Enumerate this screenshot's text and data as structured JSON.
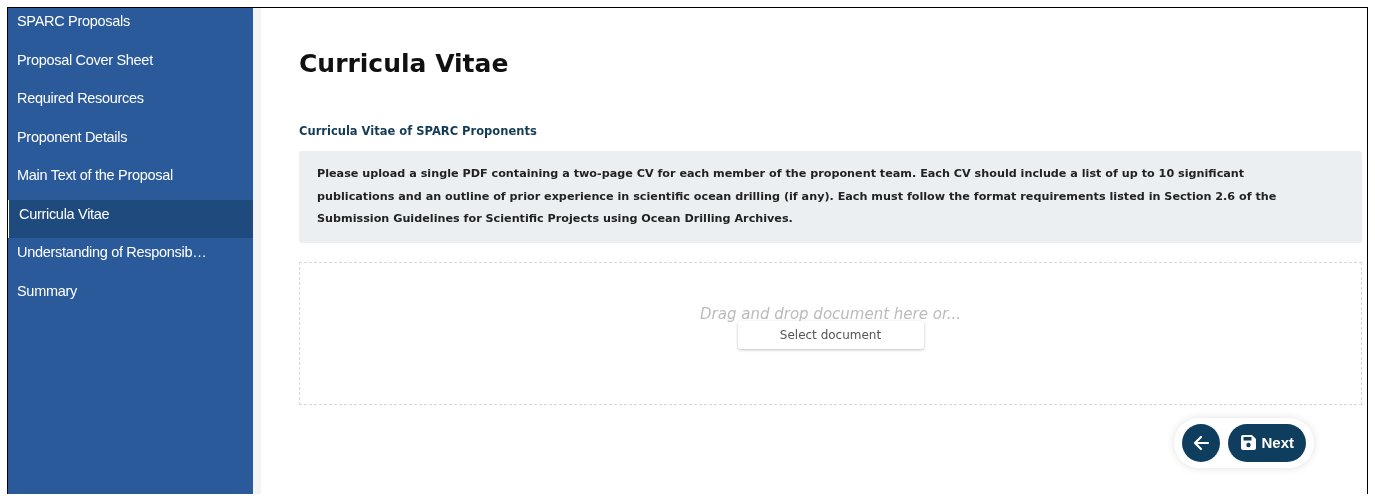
{
  "sidebar": {
    "items": [
      {
        "label": "SPARC Proposals",
        "selected": false
      },
      {
        "label": "Proposal Cover Sheet",
        "selected": false
      },
      {
        "label": "Required Resources",
        "selected": false
      },
      {
        "label": "Proponent Details",
        "selected": false
      },
      {
        "label": "Main Text of the Proposal",
        "selected": false
      },
      {
        "label": "Curricula Vitae",
        "selected": true
      },
      {
        "label": "Understanding of Responsib…",
        "selected": false
      },
      {
        "label": "Summary",
        "selected": false
      }
    ]
  },
  "page": {
    "title": "Curricula Vitae",
    "section_title": "Curricula Vitae of SPARC Proponents",
    "instructions": "Please upload a single PDF containing a two-page CV for each member of the proponent team. Each CV should include a list of up to 10 significant publications and an outline of prior experience in scientific ocean drilling (if any). Each must follow the format requirements listed in Section 2.6 of the Submission Guidelines for Scientific Projects using Ocean Drilling Archives.",
    "dropzone": {
      "hint": "Drag and drop document here or...",
      "button": "Select document"
    }
  },
  "footer": {
    "next_button": "Next"
  }
}
